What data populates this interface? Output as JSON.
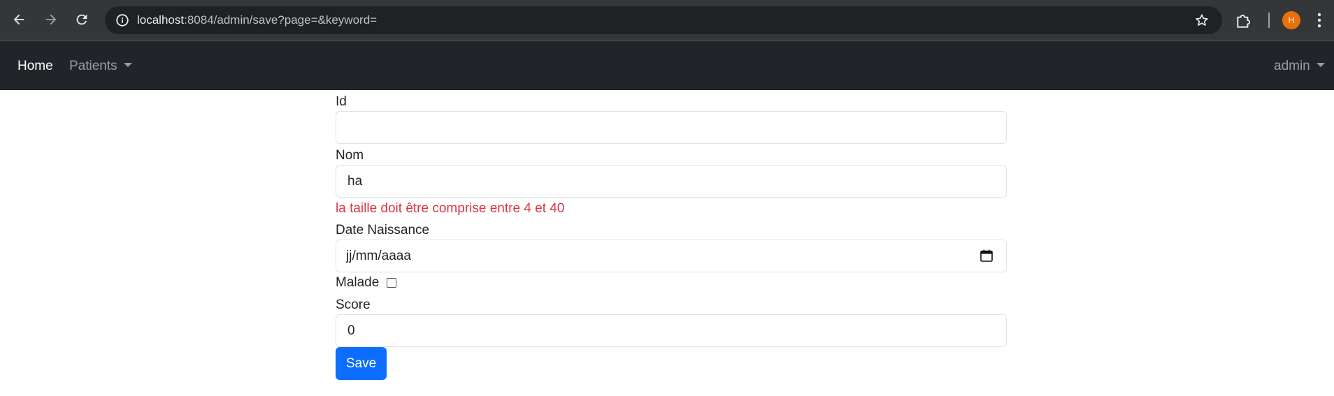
{
  "browser": {
    "url_host": "localhost",
    "url_rest": ":8084/admin/save?page=&keyword=",
    "profile_initial": "H",
    "icons": [
      "back-arrow-icon",
      "forward-arrow-icon",
      "reload-icon",
      "info-icon",
      "star-icon",
      "extensions-icon",
      "kebab-menu-icon"
    ]
  },
  "navbar": {
    "home": "Home",
    "patients": "Patients",
    "user": "admin"
  },
  "form": {
    "id_label": "Id",
    "id_value": "",
    "nom_label": "Nom",
    "nom_value": "ha",
    "nom_error": "la taille doit être comprise entre 4 et 40",
    "date_label": "Date Naissance",
    "date_placeholder": "jj/mm/aaaa",
    "malade_label": "Malade",
    "malade_checked": false,
    "score_label": "Score",
    "score_value": "0",
    "save_label": "Save"
  },
  "colors": {
    "navbar_bg": "#212529",
    "primary": "#0d6efd",
    "error": "#dc3545"
  }
}
